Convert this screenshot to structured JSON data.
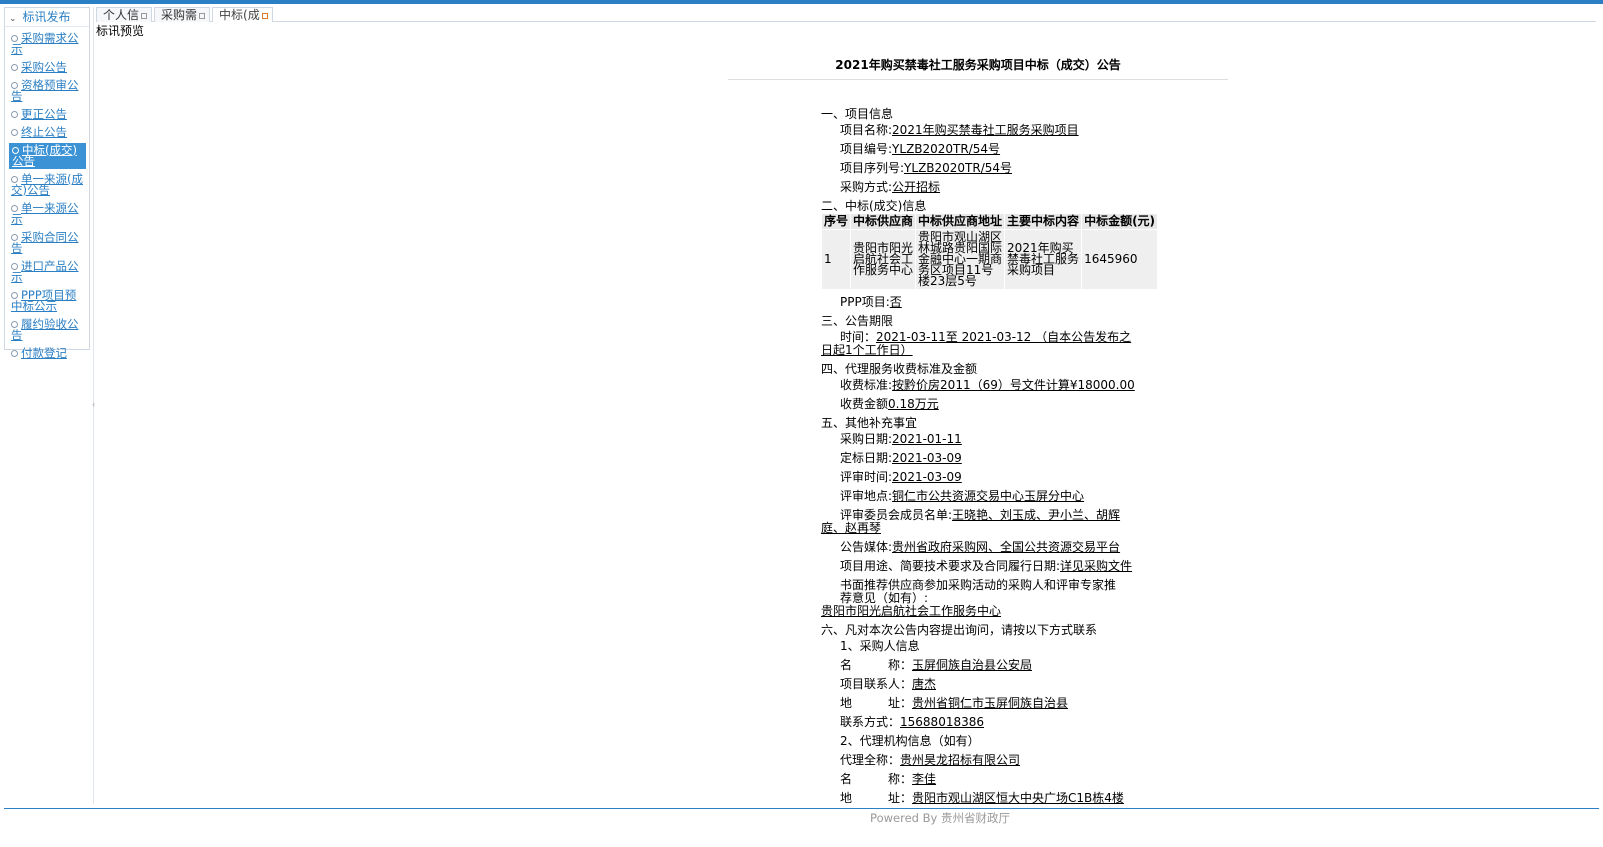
{
  "sidebar": {
    "header": "标讯发布",
    "items": [
      {
        "label": "采购需求公示"
      },
      {
        "label": "采购公告"
      },
      {
        "label": "资格预审公告"
      },
      {
        "label": "更正公告"
      },
      {
        "label": "终止公告"
      },
      {
        "label": "中标(成交)公告",
        "active": true
      },
      {
        "label": "单一来源(成交)公告"
      },
      {
        "label": "单一来源公示"
      },
      {
        "label": "采购合同公告"
      },
      {
        "label": "进口产品公示"
      },
      {
        "label": "PPP项目预中标公示"
      },
      {
        "label": "履约验收公告"
      },
      {
        "label": "付款登记"
      }
    ]
  },
  "tabs": [
    {
      "label": "个人信"
    },
    {
      "label": "采购需"
    },
    {
      "label": "中标(成",
      "active": true
    }
  ],
  "preview_label": "标讯预览",
  "document": {
    "title": "2021年购买禁毒社工服务采购项目中标（成交）公告",
    "s1": {
      "heading": "一、项目信息",
      "name_label": "项目名称:",
      "name_value": "2021年购买禁毒社工服务采购项目",
      "code_label": "项目编号:",
      "code_value": "YLZB2020TR/54号",
      "serial_label": "项目序列号:",
      "serial_value": "YLZB2020TR/54号",
      "method_label": "采购方式:",
      "method_value": "公开招标"
    },
    "s2": {
      "heading": "二、中标(成交)信息",
      "headers": [
        "序号",
        "中标供应商",
        "中标供应商地址",
        "主要中标内容",
        "中标金额(元)"
      ],
      "row": [
        "1",
        "贵阳市阳光启航社会工作服务中心",
        "贵阳市观山湖区林城路贵阳国际金融中心一期商务区项目11号楼23层5号",
        "2021年购买禁毒社工服务采购项目",
        "1645960"
      ],
      "ppp_label": "PPP项目:",
      "ppp_value": "否"
    },
    "s3": {
      "heading": "三、公告期限",
      "time_label": "时间：",
      "time_value": "2021-03-11至 2021-03-12 （自本公告发布之日起1个工作日）"
    },
    "s4": {
      "heading": "四、代理服务收费标准及金额",
      "std_label": "收费标准:",
      "std_value": "按黔价房2011（69）号文件计算¥18000.00",
      "amt_label": "收费金额",
      "amt_value": "0.18万元"
    },
    "s5": {
      "heading": "五、其他补充事宜",
      "pdate_label": "采购日期:",
      "pdate_value": "2021-01-11",
      "adate_label": "定标日期:",
      "adate_value": "2021-03-09",
      "rtime_label": "评审时间:",
      "rtime_value": "2021-03-09",
      "rplace_label": "评审地点:",
      "rplace_value": "铜仁市公共资源交易中心玉屏分中心",
      "members_label": "评审委员会成员名单:",
      "members_value": "王晓艳、刘玉成、尹小兰、胡辉庭、赵再琴",
      "media_label": "公告媒体:",
      "media_value": "贵州省政府采购网、全国公共资源交易平台",
      "usage_label": "项目用途、简要技术要求及合同履行日期:",
      "usage_value": "详见采购文件",
      "recommend_label": "书面推荐供应商参加采购活动的采购人和评审专家推荐意见（如有）:",
      "recommend_value": "贵阳市阳光启航社会工作服务中心"
    },
    "s6": {
      "heading": "六、凡对本次公告内容提出询问，请按以下方式联系",
      "p1_heading": "1、采购人信息",
      "p1_name_label": "名　　　称：",
      "p1_name_value": "玉屏侗族自治县公安局",
      "p1_contact_label": "项目联系人：",
      "p1_contact_value": "唐杰",
      "p1_addr_label": "地　　　址：",
      "p1_addr_value": "贵州省铜仁市玉屏侗族自治县",
      "p1_phone_label": "联系方式：",
      "p1_phone_value": "15688018386",
      "p2_heading": "2、代理机构信息（如有）",
      "p2_full_label": "代理全称：",
      "p2_full_value": "贵州昊龙招标有限公司",
      "p2_name_label": "名　　　称：",
      "p2_name_value": "李佳",
      "p2_addr_label": "地　　　址：",
      "p2_addr_value": "贵阳市观山湖区恒大中央广场C1B栋4楼"
    }
  },
  "footer": "Powered By 贵州省财政厅",
  "colors": {
    "accent": "#2b7fc4",
    "active_item_bg": "#3b93d6",
    "table_header_bg": "#e8e8e8"
  }
}
